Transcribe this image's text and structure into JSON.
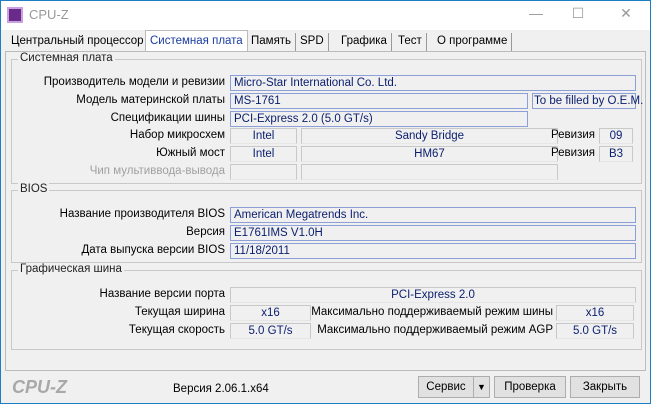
{
  "window": {
    "title": "CPU-Z",
    "minimize": "—",
    "maximize": "☐",
    "close": "✕"
  },
  "tabs": [
    "Центральный процессор",
    "Системная плата",
    "Память",
    "SPD",
    "Графика",
    "Тест",
    "О программе"
  ],
  "mainboard": {
    "group": "Системная плата",
    "manufacturer_label": "Производитель модели и ревизии",
    "manufacturer": "Micro-Star International Co. Ltd.",
    "model_label": "Модель материнской платы",
    "model": "MS-1761",
    "model_rev": "To be filled by O.E.M.",
    "bus_label": "Спецификации шины",
    "bus": "PCI-Express 2.0 (5.0 GT/s)",
    "chipset_label": "Набор микросхем",
    "chipset_vendor": "Intel",
    "chipset": "Sandy Bridge",
    "chipset_rev_label": "Ревизия",
    "chipset_rev": "09",
    "southbridge_label": "Южный мост",
    "sb_vendor": "Intel",
    "sb": "HM67",
    "sb_rev_label": "Ревизия",
    "sb_rev": "B3",
    "lpcio_label": "Чип мультиввода-вывода"
  },
  "bios": {
    "group": "BIOS",
    "brand_label": "Название производителя BIOS",
    "brand": "American Megatrends Inc.",
    "version_label": "Версия",
    "version": "E1761IMS V1.0H",
    "date_label": "Дата выпуска версии BIOS",
    "date": "11/18/2011"
  },
  "graphic": {
    "group": "Графическая шина",
    "version_label": "Название версии порта",
    "version": "PCI-Express 2.0",
    "width_label": "Текущая ширина",
    "width": "x16",
    "max_width_label": "Максимально поддерживаемый режим шины",
    "max_width": "x16",
    "speed_label": "Текущая скорость",
    "speed": "5.0 GT/s",
    "max_speed_label": "Максимально поддерживаемый режим AGP",
    "max_speed": "5.0 GT/s"
  },
  "footer": {
    "logo": "CPU-Z",
    "version": "Версия 2.06.1.x64",
    "tools": "Сервис",
    "dropdown": "▼",
    "validate": "Проверка",
    "close": "Закрыть"
  }
}
